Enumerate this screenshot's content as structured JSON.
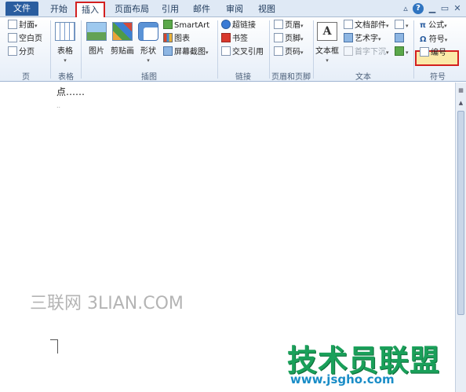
{
  "tabs": {
    "file": "文件",
    "home": "开始",
    "insert": "插入",
    "layout": "页面布局",
    "references": "引用",
    "mailings": "邮件",
    "review": "审阅",
    "view": "视图"
  },
  "groups": {
    "pages": {
      "label": "页",
      "cover": "封面",
      "blank": "空白页",
      "break": "分页"
    },
    "tables": {
      "label": "表格",
      "table": "表格"
    },
    "illustrations": {
      "label": "插图",
      "picture": "图片",
      "clipart": "剪贴画",
      "shapes": "形状",
      "smartart": "SmartArt",
      "chart": "图表",
      "screenshot": "屏幕截图"
    },
    "links": {
      "label": "链接",
      "hyperlink": "超链接",
      "bookmark": "书签",
      "crossref": "交叉引用"
    },
    "header_footer": {
      "label": "页眉和页脚",
      "header": "页眉",
      "footer": "页脚",
      "pagenum": "页码"
    },
    "text": {
      "label": "文本",
      "textbox": "文本框",
      "parts": "文档部件",
      "wordart": "艺术字",
      "dropcap": "首字下沉"
    },
    "symbols": {
      "label": "符号",
      "equation": "公式",
      "symbol": "符号",
      "number": "编号"
    }
  },
  "document": {
    "text": "点……",
    "para_mark": "..",
    "watermark_left": "三联网 3LIAN.COM",
    "watermark_right": "技术员联盟",
    "watermark_url": "www.jsgho.com"
  }
}
